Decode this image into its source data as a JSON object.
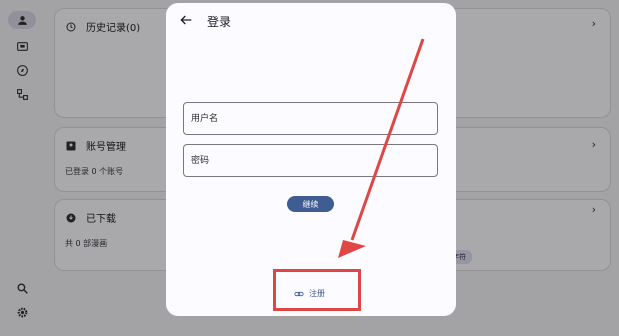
{
  "background": {
    "rail_items": [
      {
        "icon": "person-icon",
        "active": true
      },
      {
        "icon": "card-icon",
        "active": false
      },
      {
        "icon": "compass-icon",
        "active": false
      },
      {
        "icon": "hierarchy-icon",
        "active": false
      },
      {
        "icon": "search-icon",
        "active": false
      },
      {
        "icon": "gear-icon",
        "active": false
      }
    ],
    "cards": {
      "history": {
        "title": "历史记录(0)"
      },
      "accounts": {
        "title": "账号管理",
        "subtitle": "已登录 0 个账号"
      },
      "downloads": {
        "title": "已下载",
        "subtitle": "共 0 部漫画",
        "chip": "字符"
      }
    }
  },
  "dialog": {
    "title": "登录",
    "username_placeholder": "用户名",
    "password_placeholder": "密码",
    "continue_label": "继续",
    "register_label": "注册"
  },
  "annotation": {
    "color": "#e04646"
  }
}
